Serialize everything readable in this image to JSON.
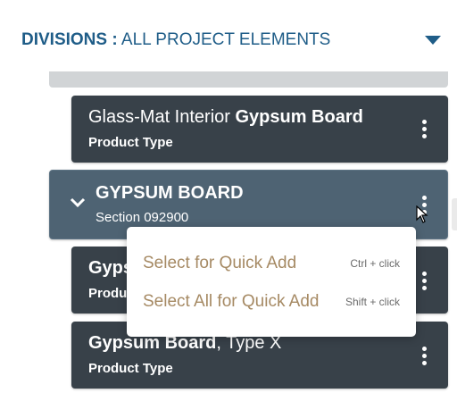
{
  "header": {
    "title_bold": "DIVISIONS :",
    "title_rest": "ALL PROJECT ELEMENTS",
    "chevron_icon": "chevron-down-icon",
    "accent_color": "#1f5d88"
  },
  "items": [
    {
      "name_prefix": "Glass-Mat Interior ",
      "name_bold": "Gypsum Board",
      "subtitle": "Product Type"
    },
    {
      "name": "GYPSUM BOARD",
      "subtitle": "Section 092900",
      "expanded": true
    },
    {
      "name_visible": "Gyps",
      "subtitle_visible": "Produ"
    },
    {
      "name_bold": "Gypsum Board",
      "name_rest": ", Type X",
      "subtitle": "Product Type"
    }
  ],
  "context_menu": {
    "items": [
      {
        "label": "Select for Quick Add",
        "shortcut": "Ctrl + click"
      },
      {
        "label": "Select All for Quick Add",
        "shortcut": "Shift + click"
      }
    ]
  },
  "colors": {
    "card_bg": "#384149",
    "section_bg": "#4e6373",
    "menu_label": "#a68a64"
  }
}
